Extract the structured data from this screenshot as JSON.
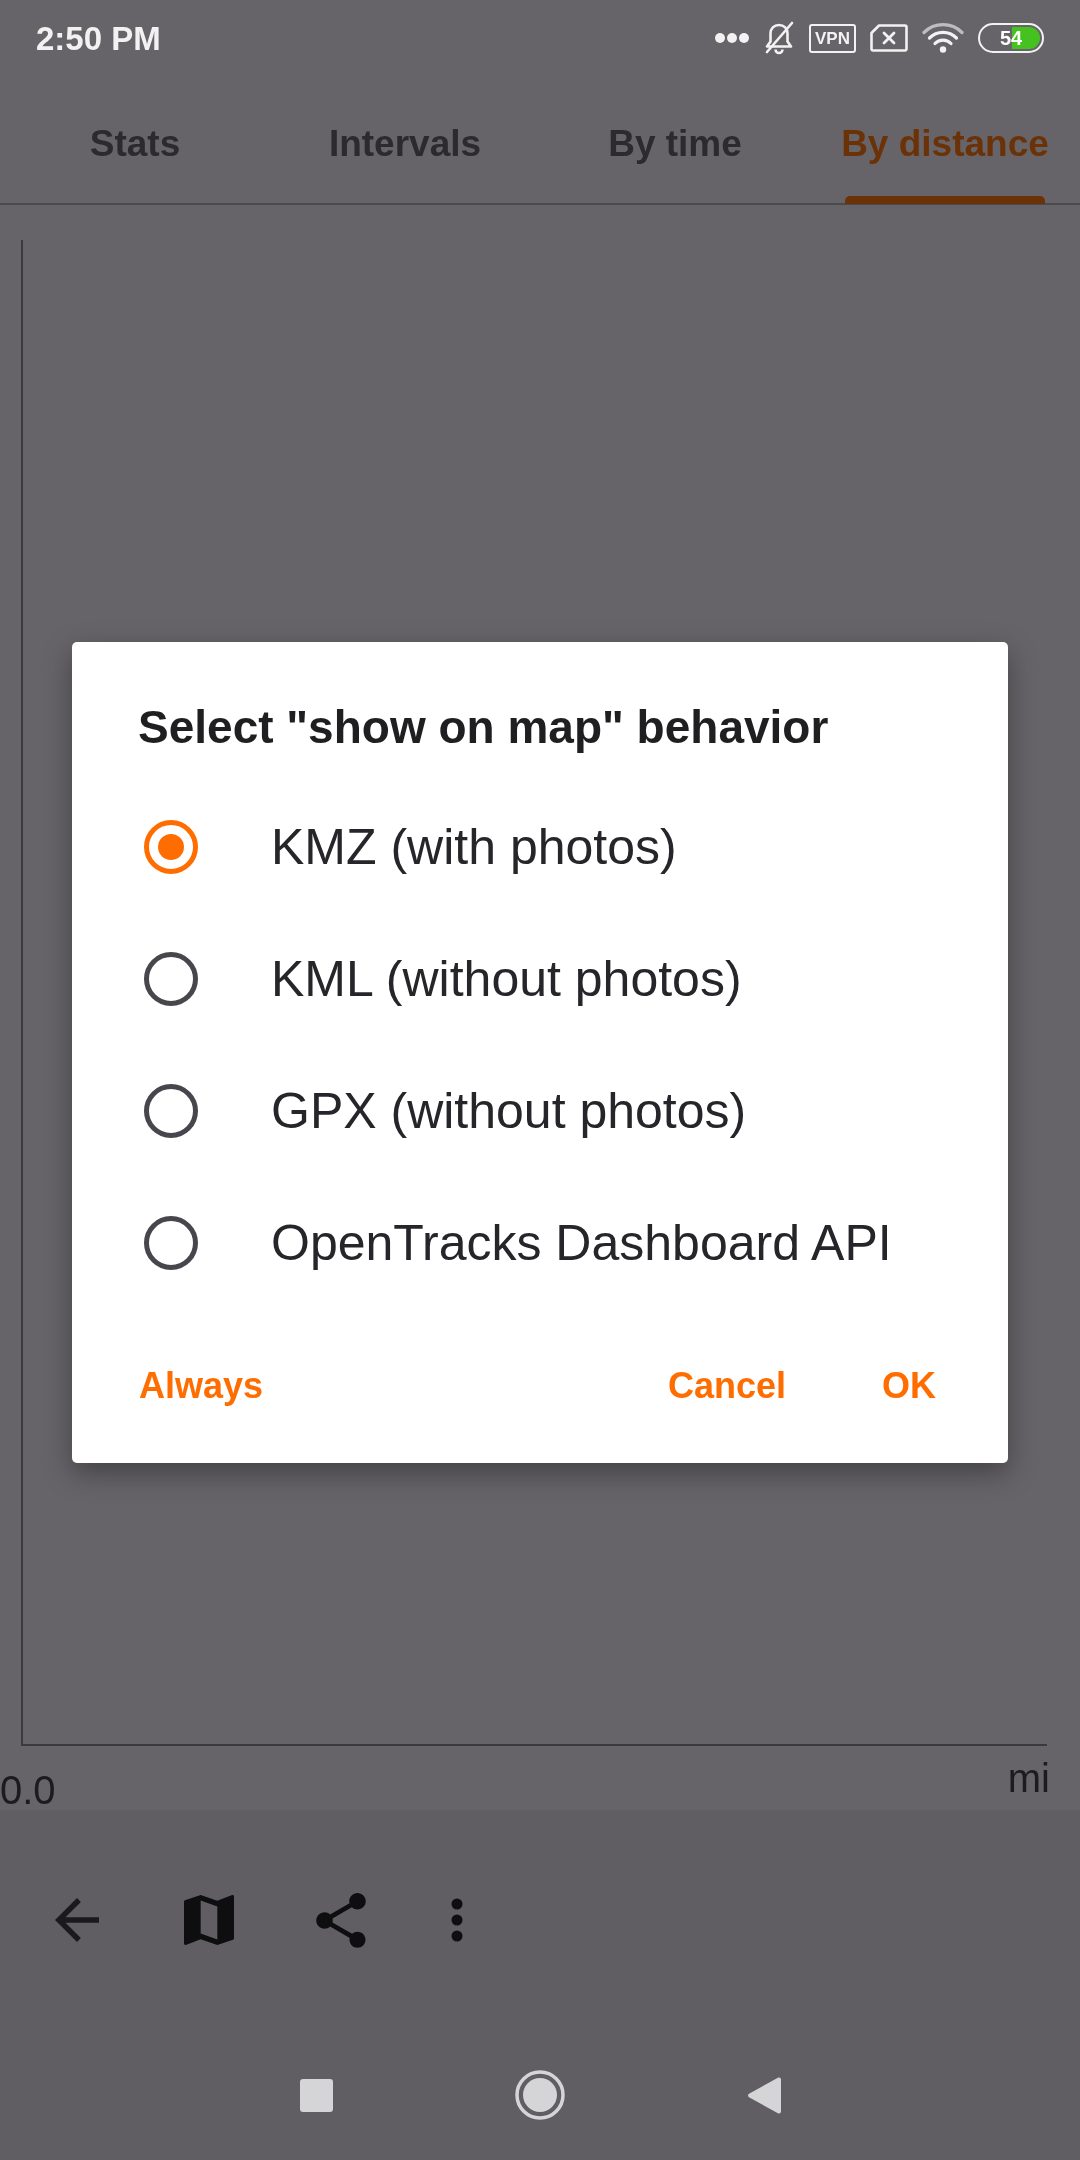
{
  "status_bar": {
    "time": "2:50 PM",
    "vpn": "VPN",
    "battery": "54"
  },
  "tabs": [
    {
      "label": "Stats",
      "selected": false
    },
    {
      "label": "Intervals",
      "selected": false
    },
    {
      "label": "By time",
      "selected": false
    },
    {
      "label": "By distance",
      "selected": true
    }
  ],
  "chart": {
    "x_start": "0.0",
    "x_unit": "mi"
  },
  "dialog": {
    "title": "Select \"show on map\" behavior",
    "options": [
      {
        "label": "KMZ (with photos)",
        "selected": true
      },
      {
        "label": "KML (without photos)",
        "selected": false
      },
      {
        "label": "GPX (without photos)",
        "selected": false
      },
      {
        "label": "OpenTracks Dashboard API",
        "selected": false
      }
    ],
    "buttons": [
      "Always",
      "Cancel",
      "OK"
    ]
  }
}
